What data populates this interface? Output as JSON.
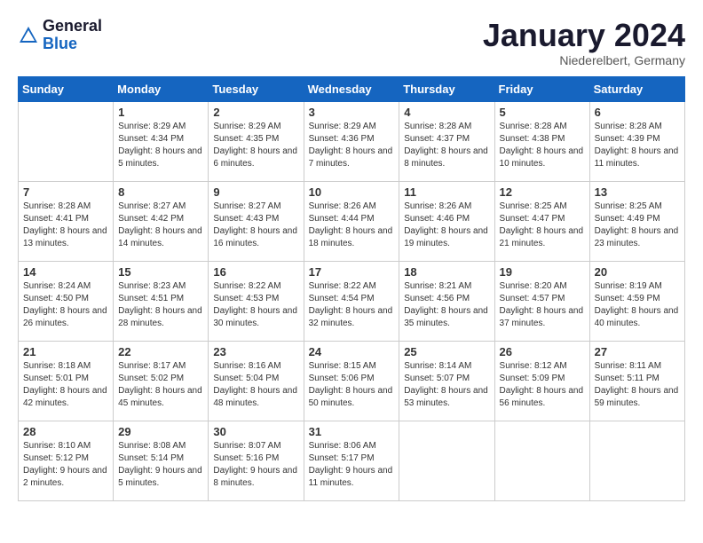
{
  "header": {
    "logo": {
      "general": "General",
      "blue": "Blue"
    },
    "title": "January 2024",
    "location": "Niederelbert, Germany"
  },
  "calendar": {
    "days_of_week": [
      "Sunday",
      "Monday",
      "Tuesday",
      "Wednesday",
      "Thursday",
      "Friday",
      "Saturday"
    ],
    "weeks": [
      [
        {
          "day": "",
          "sunrise": "",
          "sunset": "",
          "daylight": "",
          "empty": true
        },
        {
          "day": "1",
          "sunrise": "Sunrise: 8:29 AM",
          "sunset": "Sunset: 4:34 PM",
          "daylight": "Daylight: 8 hours and 5 minutes."
        },
        {
          "day": "2",
          "sunrise": "Sunrise: 8:29 AM",
          "sunset": "Sunset: 4:35 PM",
          "daylight": "Daylight: 8 hours and 6 minutes."
        },
        {
          "day": "3",
          "sunrise": "Sunrise: 8:29 AM",
          "sunset": "Sunset: 4:36 PM",
          "daylight": "Daylight: 8 hours and 7 minutes."
        },
        {
          "day": "4",
          "sunrise": "Sunrise: 8:28 AM",
          "sunset": "Sunset: 4:37 PM",
          "daylight": "Daylight: 8 hours and 8 minutes."
        },
        {
          "day": "5",
          "sunrise": "Sunrise: 8:28 AM",
          "sunset": "Sunset: 4:38 PM",
          "daylight": "Daylight: 8 hours and 10 minutes."
        },
        {
          "day": "6",
          "sunrise": "Sunrise: 8:28 AM",
          "sunset": "Sunset: 4:39 PM",
          "daylight": "Daylight: 8 hours and 11 minutes."
        }
      ],
      [
        {
          "day": "7",
          "sunrise": "Sunrise: 8:28 AM",
          "sunset": "Sunset: 4:41 PM",
          "daylight": "Daylight: 8 hours and 13 minutes."
        },
        {
          "day": "8",
          "sunrise": "Sunrise: 8:27 AM",
          "sunset": "Sunset: 4:42 PM",
          "daylight": "Daylight: 8 hours and 14 minutes."
        },
        {
          "day": "9",
          "sunrise": "Sunrise: 8:27 AM",
          "sunset": "Sunset: 4:43 PM",
          "daylight": "Daylight: 8 hours and 16 minutes."
        },
        {
          "day": "10",
          "sunrise": "Sunrise: 8:26 AM",
          "sunset": "Sunset: 4:44 PM",
          "daylight": "Daylight: 8 hours and 18 minutes."
        },
        {
          "day": "11",
          "sunrise": "Sunrise: 8:26 AM",
          "sunset": "Sunset: 4:46 PM",
          "daylight": "Daylight: 8 hours and 19 minutes."
        },
        {
          "day": "12",
          "sunrise": "Sunrise: 8:25 AM",
          "sunset": "Sunset: 4:47 PM",
          "daylight": "Daylight: 8 hours and 21 minutes."
        },
        {
          "day": "13",
          "sunrise": "Sunrise: 8:25 AM",
          "sunset": "Sunset: 4:49 PM",
          "daylight": "Daylight: 8 hours and 23 minutes."
        }
      ],
      [
        {
          "day": "14",
          "sunrise": "Sunrise: 8:24 AM",
          "sunset": "Sunset: 4:50 PM",
          "daylight": "Daylight: 8 hours and 26 minutes."
        },
        {
          "day": "15",
          "sunrise": "Sunrise: 8:23 AM",
          "sunset": "Sunset: 4:51 PM",
          "daylight": "Daylight: 8 hours and 28 minutes."
        },
        {
          "day": "16",
          "sunrise": "Sunrise: 8:22 AM",
          "sunset": "Sunset: 4:53 PM",
          "daylight": "Daylight: 8 hours and 30 minutes."
        },
        {
          "day": "17",
          "sunrise": "Sunrise: 8:22 AM",
          "sunset": "Sunset: 4:54 PM",
          "daylight": "Daylight: 8 hours and 32 minutes."
        },
        {
          "day": "18",
          "sunrise": "Sunrise: 8:21 AM",
          "sunset": "Sunset: 4:56 PM",
          "daylight": "Daylight: 8 hours and 35 minutes."
        },
        {
          "day": "19",
          "sunrise": "Sunrise: 8:20 AM",
          "sunset": "Sunset: 4:57 PM",
          "daylight": "Daylight: 8 hours and 37 minutes."
        },
        {
          "day": "20",
          "sunrise": "Sunrise: 8:19 AM",
          "sunset": "Sunset: 4:59 PM",
          "daylight": "Daylight: 8 hours and 40 minutes."
        }
      ],
      [
        {
          "day": "21",
          "sunrise": "Sunrise: 8:18 AM",
          "sunset": "Sunset: 5:01 PM",
          "daylight": "Daylight: 8 hours and 42 minutes."
        },
        {
          "day": "22",
          "sunrise": "Sunrise: 8:17 AM",
          "sunset": "Sunset: 5:02 PM",
          "daylight": "Daylight: 8 hours and 45 minutes."
        },
        {
          "day": "23",
          "sunrise": "Sunrise: 8:16 AM",
          "sunset": "Sunset: 5:04 PM",
          "daylight": "Daylight: 8 hours and 48 minutes."
        },
        {
          "day": "24",
          "sunrise": "Sunrise: 8:15 AM",
          "sunset": "Sunset: 5:06 PM",
          "daylight": "Daylight: 8 hours and 50 minutes."
        },
        {
          "day": "25",
          "sunrise": "Sunrise: 8:14 AM",
          "sunset": "Sunset: 5:07 PM",
          "daylight": "Daylight: 8 hours and 53 minutes."
        },
        {
          "day": "26",
          "sunrise": "Sunrise: 8:12 AM",
          "sunset": "Sunset: 5:09 PM",
          "daylight": "Daylight: 8 hours and 56 minutes."
        },
        {
          "day": "27",
          "sunrise": "Sunrise: 8:11 AM",
          "sunset": "Sunset: 5:11 PM",
          "daylight": "Daylight: 8 hours and 59 minutes."
        }
      ],
      [
        {
          "day": "28",
          "sunrise": "Sunrise: 8:10 AM",
          "sunset": "Sunset: 5:12 PM",
          "daylight": "Daylight: 9 hours and 2 minutes."
        },
        {
          "day": "29",
          "sunrise": "Sunrise: 8:08 AM",
          "sunset": "Sunset: 5:14 PM",
          "daylight": "Daylight: 9 hours and 5 minutes."
        },
        {
          "day": "30",
          "sunrise": "Sunrise: 8:07 AM",
          "sunset": "Sunset: 5:16 PM",
          "daylight": "Daylight: 9 hours and 8 minutes."
        },
        {
          "day": "31",
          "sunrise": "Sunrise: 8:06 AM",
          "sunset": "Sunset: 5:17 PM",
          "daylight": "Daylight: 9 hours and 11 minutes."
        },
        {
          "day": "",
          "sunrise": "",
          "sunset": "",
          "daylight": "",
          "empty": true
        },
        {
          "day": "",
          "sunrise": "",
          "sunset": "",
          "daylight": "",
          "empty": true
        },
        {
          "day": "",
          "sunrise": "",
          "sunset": "",
          "daylight": "",
          "empty": true
        }
      ]
    ]
  }
}
